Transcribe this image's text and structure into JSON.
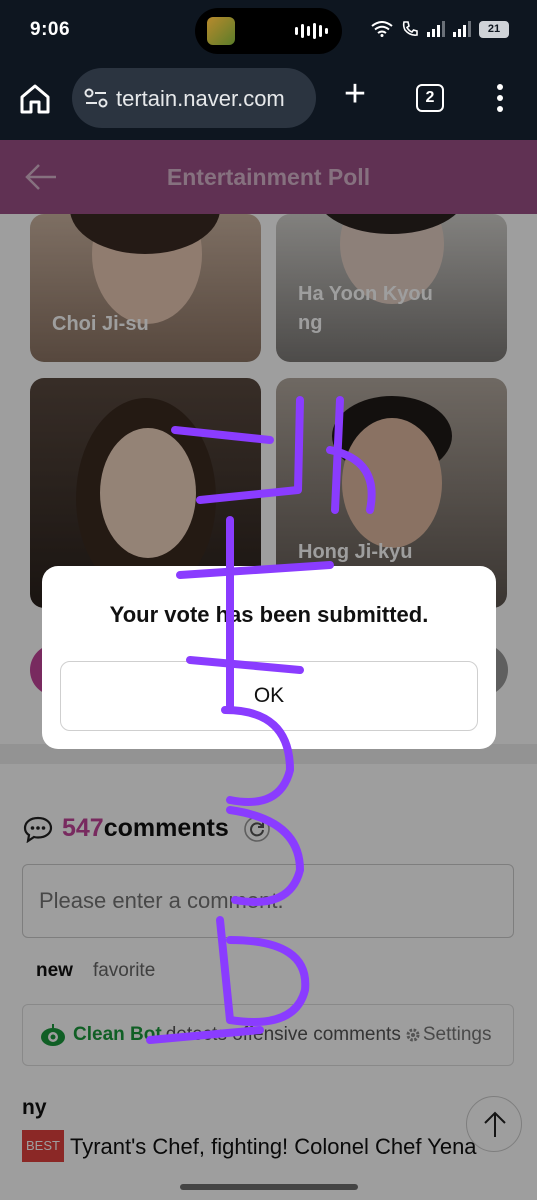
{
  "status_bar": {
    "time": "9:06",
    "battery": "21"
  },
  "browser": {
    "url": "tertain.naver.com",
    "tab_count": "2"
  },
  "header": {
    "title": "Entertainment Poll"
  },
  "candidates": [
    {
      "name": "Choi Ji-su"
    },
    {
      "name": "Ha Yoon Kyou\nng"
    },
    {
      "name": "Hong Ji-kyu"
    }
  ],
  "dialog": {
    "message": "Your vote has been submitted.",
    "ok_label": "OK"
  },
  "comments": {
    "count": "547",
    "word": "comments",
    "input_placeholder": "Please enter a comment.",
    "sort_new": "new",
    "sort_favorite": "favorite",
    "cleanbot_name": "Clean Bot",
    "cleanbot_text": "detects offensive comments",
    "settings_label": "Settings",
    "first_user": "ny",
    "best_badge": "BEST",
    "first_text": "Tyrant's Chef, fighting! Colonel Chef Yena"
  },
  "colors": {
    "accent": "#c2449a",
    "header_bg": "#9c4f86",
    "scribble": "#8a3cff"
  }
}
